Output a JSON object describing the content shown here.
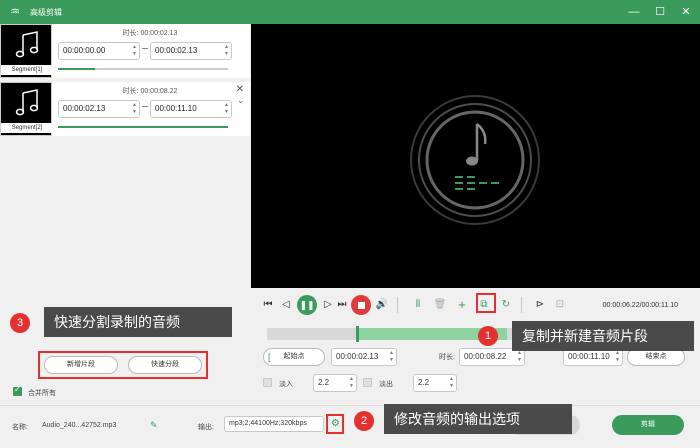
{
  "titlebar": {
    "title": "高级剪辑"
  },
  "segments": [
    {
      "caption": "Segment[1]",
      "duration": "时长: 00:00:02.13",
      "start": "00:00:00.00",
      "end": "00:00:02.13",
      "progress": 0.22
    },
    {
      "caption": "Segment[2]",
      "duration": "时长: 00:00:08.22",
      "start": "00:00:02.13",
      "end": "00:00:11.10",
      "progress": 1.0
    }
  ],
  "player": {
    "timecode": "00:00:06.22/00:00:11.10"
  },
  "trim": {
    "start_label": "起始点",
    "start_value": "00:00:02.13",
    "duration_label": "时长:",
    "duration_value": "00:00:08.22",
    "end_value": "00:00:11.10",
    "end_label": "结束点"
  },
  "fade": {
    "fade_in_label": "淡入",
    "fade_in_value": "2.2",
    "fade_out_label": "淡出",
    "fade_out_value": "2.2"
  },
  "actions": {
    "new_segment": "新增片段",
    "quick_split": "快速分段",
    "merge_all": "合并所有",
    "merge_all_checked": true
  },
  "bottom": {
    "name_label": "名称:",
    "name_value": "Audio_240...42752.mp3",
    "output_label": "输出:",
    "output_value": "mp3;2;44100Hz;320kbps",
    "reset": "返回",
    "cut": "剪辑"
  },
  "annotations": [
    {
      "num": "1",
      "text": "复制并新建音频片段"
    },
    {
      "num": "2",
      "text": "修改音频的输出选项"
    },
    {
      "num": "3",
      "text": "快速分割录制的音频"
    }
  ],
  "colors": {
    "accent": "#3a9b5c",
    "stop": "#e03a3a",
    "annotation_red": "#e53030",
    "annotation_bg": "#4a4a4a"
  }
}
